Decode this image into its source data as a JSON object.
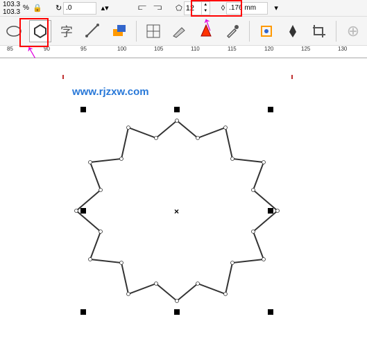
{
  "zoom": {
    "x": "103.3",
    "y": "103.3",
    "unit": "%"
  },
  "rotation": {
    "value": ".0",
    "icon": "↻"
  },
  "sides": {
    "value": "12"
  },
  "outline": {
    "value": ".176 mm"
  },
  "watermark": "www.rjzxw.com",
  "ruler": {
    "ticks": [
      "85",
      "90",
      "95",
      "100",
      "105",
      "110",
      "115",
      "120",
      "125",
      "130"
    ]
  },
  "tools": {
    "ellipse": "○",
    "polygon": "⬡",
    "text": "字",
    "star": "✦",
    "shape1": "▰",
    "shape2": "▱",
    "arrange": "▥",
    "combine": "◧",
    "edit": "✎",
    "dropper": "✐",
    "colorpick": "◈",
    "fill": "▣",
    "pen": "✒",
    "crop": "◫",
    "add": "⊕"
  }
}
